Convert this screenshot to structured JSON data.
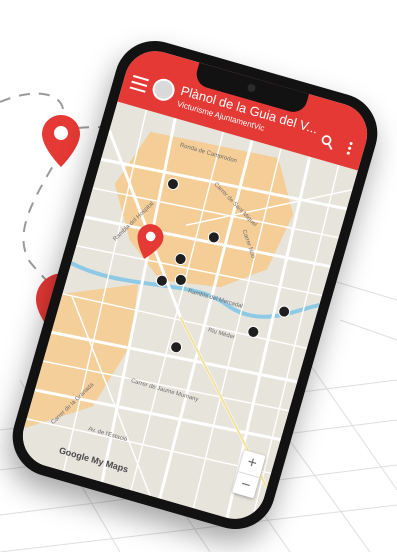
{
  "app": {
    "title": "Plànol de la Guia del V...",
    "subtitle": "Victurisme AjuntamentVic"
  },
  "icons": {
    "menu": "menu-icon",
    "search": "search-icon",
    "overflow": "more-vert-icon",
    "avatar": "avatar-logo"
  },
  "map": {
    "streets": [
      "Ronda de Camprodon",
      "Carrer de la Riera",
      "Carrer de Sant Miquel",
      "Carrer de la Concepció",
      "Carrer Nou",
      "Rambla del Hospital",
      "Rambla del Passeig",
      "Rambla del Mercadal",
      "Riu Mèder",
      "Carrer del Pont",
      "Carrer del Pare Miquel",
      "Carrer de Jaume Mumany",
      "Carrer de la Granada",
      "Av. de l'Estació",
      "Carrer de Jaume Balmes",
      "Passeig Castell",
      "Passeig del Ter",
      "Carrer Prat"
    ],
    "attribution": "Google My Maps",
    "zoom_in": "+",
    "zoom_out": "−"
  },
  "colors": {
    "accent": "#e53935",
    "pin": "#e53935",
    "highlight_area": "#f7c98a",
    "map_background": "#e7e4dc",
    "river": "#8ecae6"
  }
}
